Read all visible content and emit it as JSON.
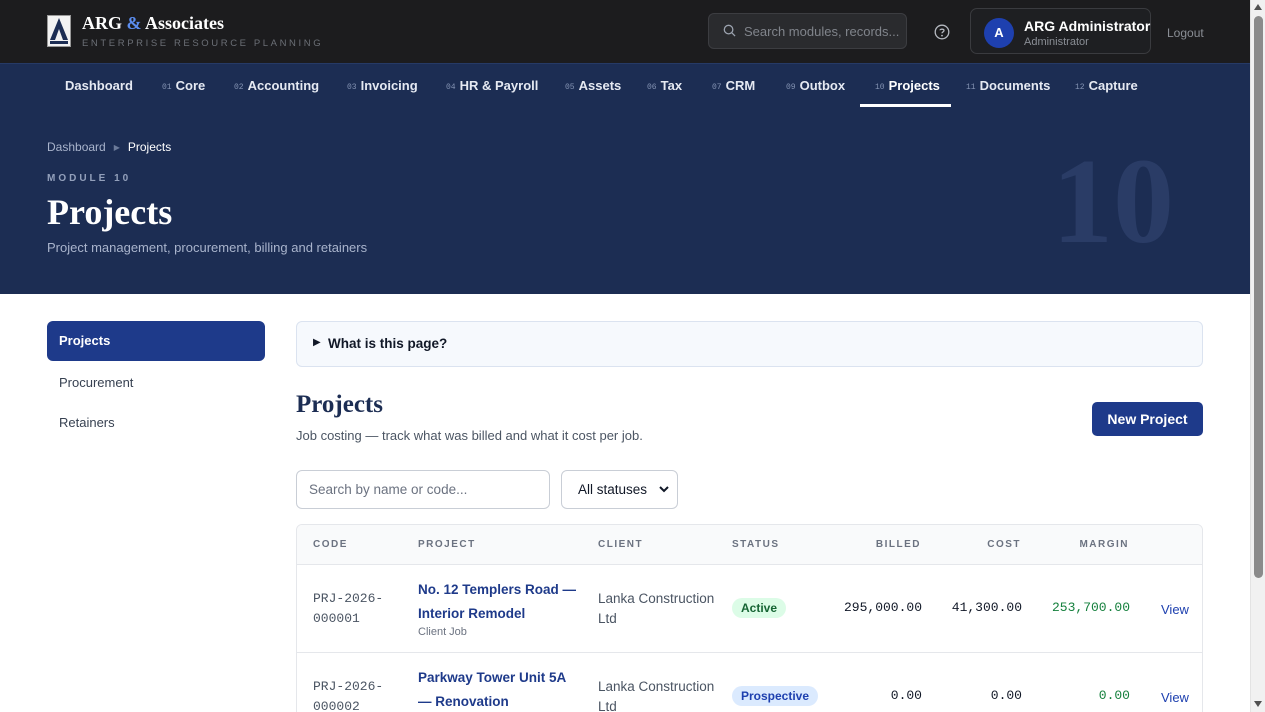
{
  "brand": {
    "name_part1": "ARG",
    "name_amp": "&",
    "name_part2": "Associates",
    "tagline": "ENTERPRISE RESOURCE PLANNING",
    "accent_color": "#5b8def"
  },
  "header": {
    "search_placeholder": "Search modules, records...",
    "help_icon": "question-circle-icon",
    "user": {
      "initial": "A",
      "name": "ARG Administrator",
      "role": "Administrator"
    },
    "logout_label": "Logout"
  },
  "nav": {
    "items": [
      {
        "num": "",
        "label": "Dashboard"
      },
      {
        "num": "01",
        "label": "Core"
      },
      {
        "num": "02",
        "label": "Accounting"
      },
      {
        "num": "03",
        "label": "Invoicing"
      },
      {
        "num": "04",
        "label": "HR & Payroll"
      },
      {
        "num": "05",
        "label": "Assets"
      },
      {
        "num": "06",
        "label": "Tax"
      },
      {
        "num": "07",
        "label": "CRM"
      },
      {
        "num": "09",
        "label": "Outbox"
      },
      {
        "num": "10",
        "label": "Projects"
      },
      {
        "num": "11",
        "label": "Documents"
      },
      {
        "num": "12",
        "label": "Capture"
      }
    ],
    "active": "Projects",
    "bg_color": "#1c2d53"
  },
  "hero": {
    "breadcrumb": [
      "Dashboard",
      "Projects"
    ],
    "module_label": "MODULE 10",
    "title": "Projects",
    "subtitle": "Project management, procurement, billing and retainers",
    "watermark": "10"
  },
  "sidebar": {
    "items": [
      {
        "label": "Projects"
      },
      {
        "label": "Procurement"
      },
      {
        "label": "Retainers"
      }
    ],
    "active": "Projects"
  },
  "main": {
    "info_toggle": "What is this page?",
    "title": "Projects",
    "subtitle": "Job costing — track what was billed and what it cost per job.",
    "new_button": "New Project",
    "search_placeholder": "Search by name or code...",
    "status_filter": "All statuses",
    "table": {
      "columns": [
        "CODE",
        "PROJECT",
        "CLIENT",
        "STATUS",
        "BILLED",
        "COST",
        "MARGIN"
      ],
      "rows": [
        {
          "code": "PRJ-2026-000001",
          "project": "No. 12 Templers Road — Interior Remodel",
          "type": "Client Job",
          "client": "Lanka Construction Ltd",
          "status": "Active",
          "billed": "295,000.00",
          "cost": "41,300.00",
          "margin": "253,700.00",
          "action": "View"
        },
        {
          "code": "PRJ-2026-000002",
          "project": "Parkway Tower Unit 5A — Renovation",
          "type": "",
          "client": "Lanka Construction Ltd",
          "status": "Prospective",
          "billed": "0.00",
          "cost": "0.00",
          "margin": "0.00",
          "action": "View"
        }
      ]
    }
  },
  "colors": {
    "primary": "#1e3a8a",
    "status_active_bg": "#dcfce7",
    "status_prospective_bg": "#dbeafe",
    "margin_positive": "#15803d"
  }
}
